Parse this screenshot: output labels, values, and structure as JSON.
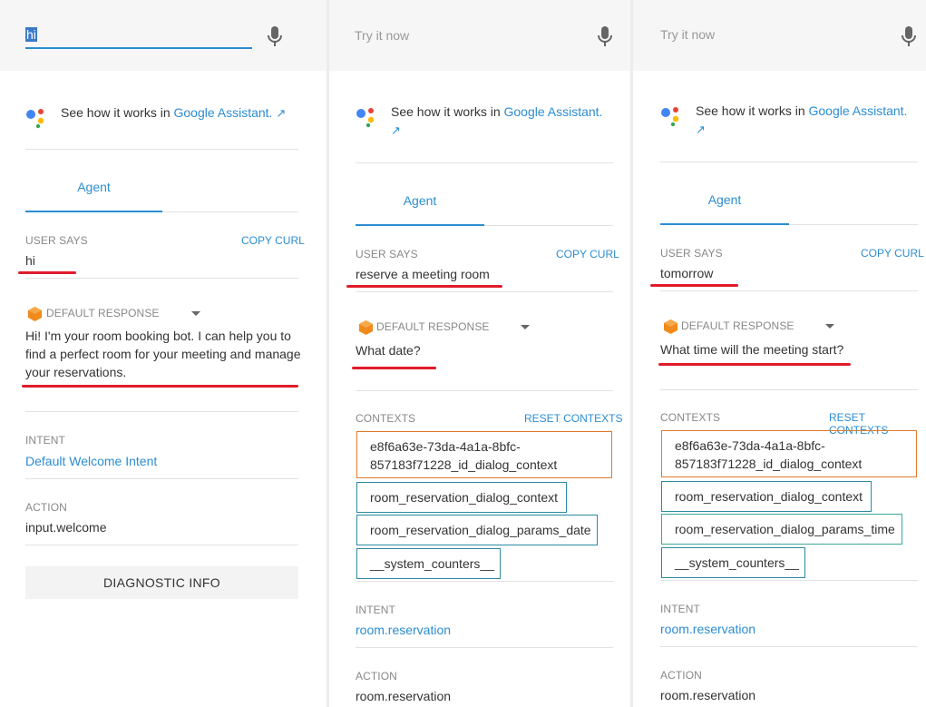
{
  "common": {
    "see_how_prefix": "See how it works in ",
    "google_assistant_link": "Google Assistant.",
    "agent_tab": "Agent",
    "user_says_label": "USER SAYS",
    "copy_curl": "COPY CURL",
    "default_response_label": "DEFAULT RESPONSE",
    "contexts_label": "CONTEXTS",
    "reset_contexts": "RESET CONTEXTS",
    "intent_label": "INTENT",
    "action_label": "ACTION",
    "try_placeholder": "Try it now"
  },
  "panels": [
    {
      "input_value": "hi",
      "user_says": "hi",
      "response": "Hi! I'm your room booking bot. I can help you to find a perfect room for your meeting and manage your reservations.",
      "intent": "Default Welcome Intent",
      "action": "input.welcome",
      "diagnostic": "DIAGNOSTIC INFO"
    },
    {
      "input_value": "",
      "user_says": "reserve a meeting room",
      "response": "What date?",
      "contexts": [
        "e8f6a63e-73da-4a1a-8bfc-857183f71228_id_dialog_context",
        "room_reservation_dialog_context",
        "room_reservation_dialog_params_date",
        "__system_counters__"
      ],
      "intent": "room.reservation",
      "action": "room.reservation"
    },
    {
      "input_value": "",
      "user_says": "tomorrow",
      "response": "What time will the meeting start?",
      "contexts": [
        "e8f6a63e-73da-4a1a-8bfc-857183f71228_id_dialog_context",
        "room_reservation_dialog_context",
        "room_reservation_dialog_params_time",
        "__system_counters__"
      ],
      "intent": "room.reservation",
      "action": "room.reservation"
    }
  ],
  "colors": {
    "accent": "#2c8dd3",
    "annotation": "#e01b2a",
    "context_orange": "#e07a2c",
    "context_teal": "#2c8aa3"
  }
}
